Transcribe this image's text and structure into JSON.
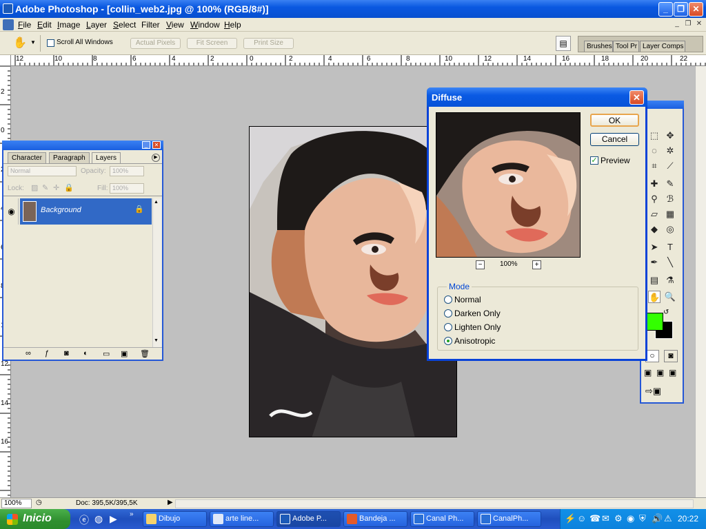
{
  "window": {
    "title": "Adobe Photoshop - [collin_web2.jpg @ 100% (RGB/8#)]",
    "minimize_glyph": "_",
    "restore_glyph": "❐",
    "close_glyph": "✕"
  },
  "menu": [
    "File",
    "Edit",
    "Image",
    "Layer",
    "Select",
    "Filter",
    "View",
    "Window",
    "Help"
  ],
  "menu_underline": [
    "F",
    "E",
    "I",
    "L",
    "S",
    "T",
    "V",
    "W",
    "H"
  ],
  "options": {
    "scroll_all_windows": "Scroll All Windows",
    "actual_pixels": "Actual Pixels",
    "fit_screen": "Fit Screen",
    "print_size": "Print Size",
    "palette_well_tabs": [
      "Brushes",
      "Tool Pr",
      "Layer Comps"
    ]
  },
  "ruler_h": [
    "12",
    "10",
    "8",
    "6",
    "4",
    "2",
    "0",
    "2",
    "4",
    "6",
    "8",
    "10",
    "12",
    "14",
    "16",
    "18",
    "20",
    "22"
  ],
  "ruler_v": [
    "2",
    "0",
    "2",
    "4",
    "6",
    "8",
    "10",
    "12",
    "14",
    "16",
    "1",
    "2",
    "4",
    "6",
    "8"
  ],
  "layers_panel": {
    "tabs": [
      "Character",
      "Paragraph",
      "Layers"
    ],
    "blend_mode": "Normal",
    "opacity_label": "Opacity:",
    "opacity_value": "100%",
    "lock_label": "Lock:",
    "fill_label": "Fill:",
    "fill_value": "100%",
    "layer_name": "Background"
  },
  "dialog": {
    "title": "Diffuse",
    "ok": "OK",
    "cancel": "Cancel",
    "preview_label": "Preview",
    "preview_checked": true,
    "zoom_value": "100%",
    "zoom_minus": "−",
    "zoom_plus": "+",
    "mode_label": "Mode",
    "modes": [
      "Normal",
      "Darken Only",
      "Lighten Only",
      "Anisotropic"
    ],
    "selected_mode": "Anisotropic"
  },
  "toolbox": {
    "foreground_color": "#33ff00",
    "background_color": "#000000"
  },
  "status": {
    "zoom": "100%",
    "doc": "Doc: 395,5K/395,5K"
  },
  "taskbar": {
    "start_label": "Inicio",
    "tasks": [
      "Dibujo",
      "arte line...",
      "Adobe P...",
      "Bandeja ...",
      "Canal Ph...",
      "CanalPh..."
    ],
    "active_task": "Adobe P...",
    "clock": "20:22"
  }
}
